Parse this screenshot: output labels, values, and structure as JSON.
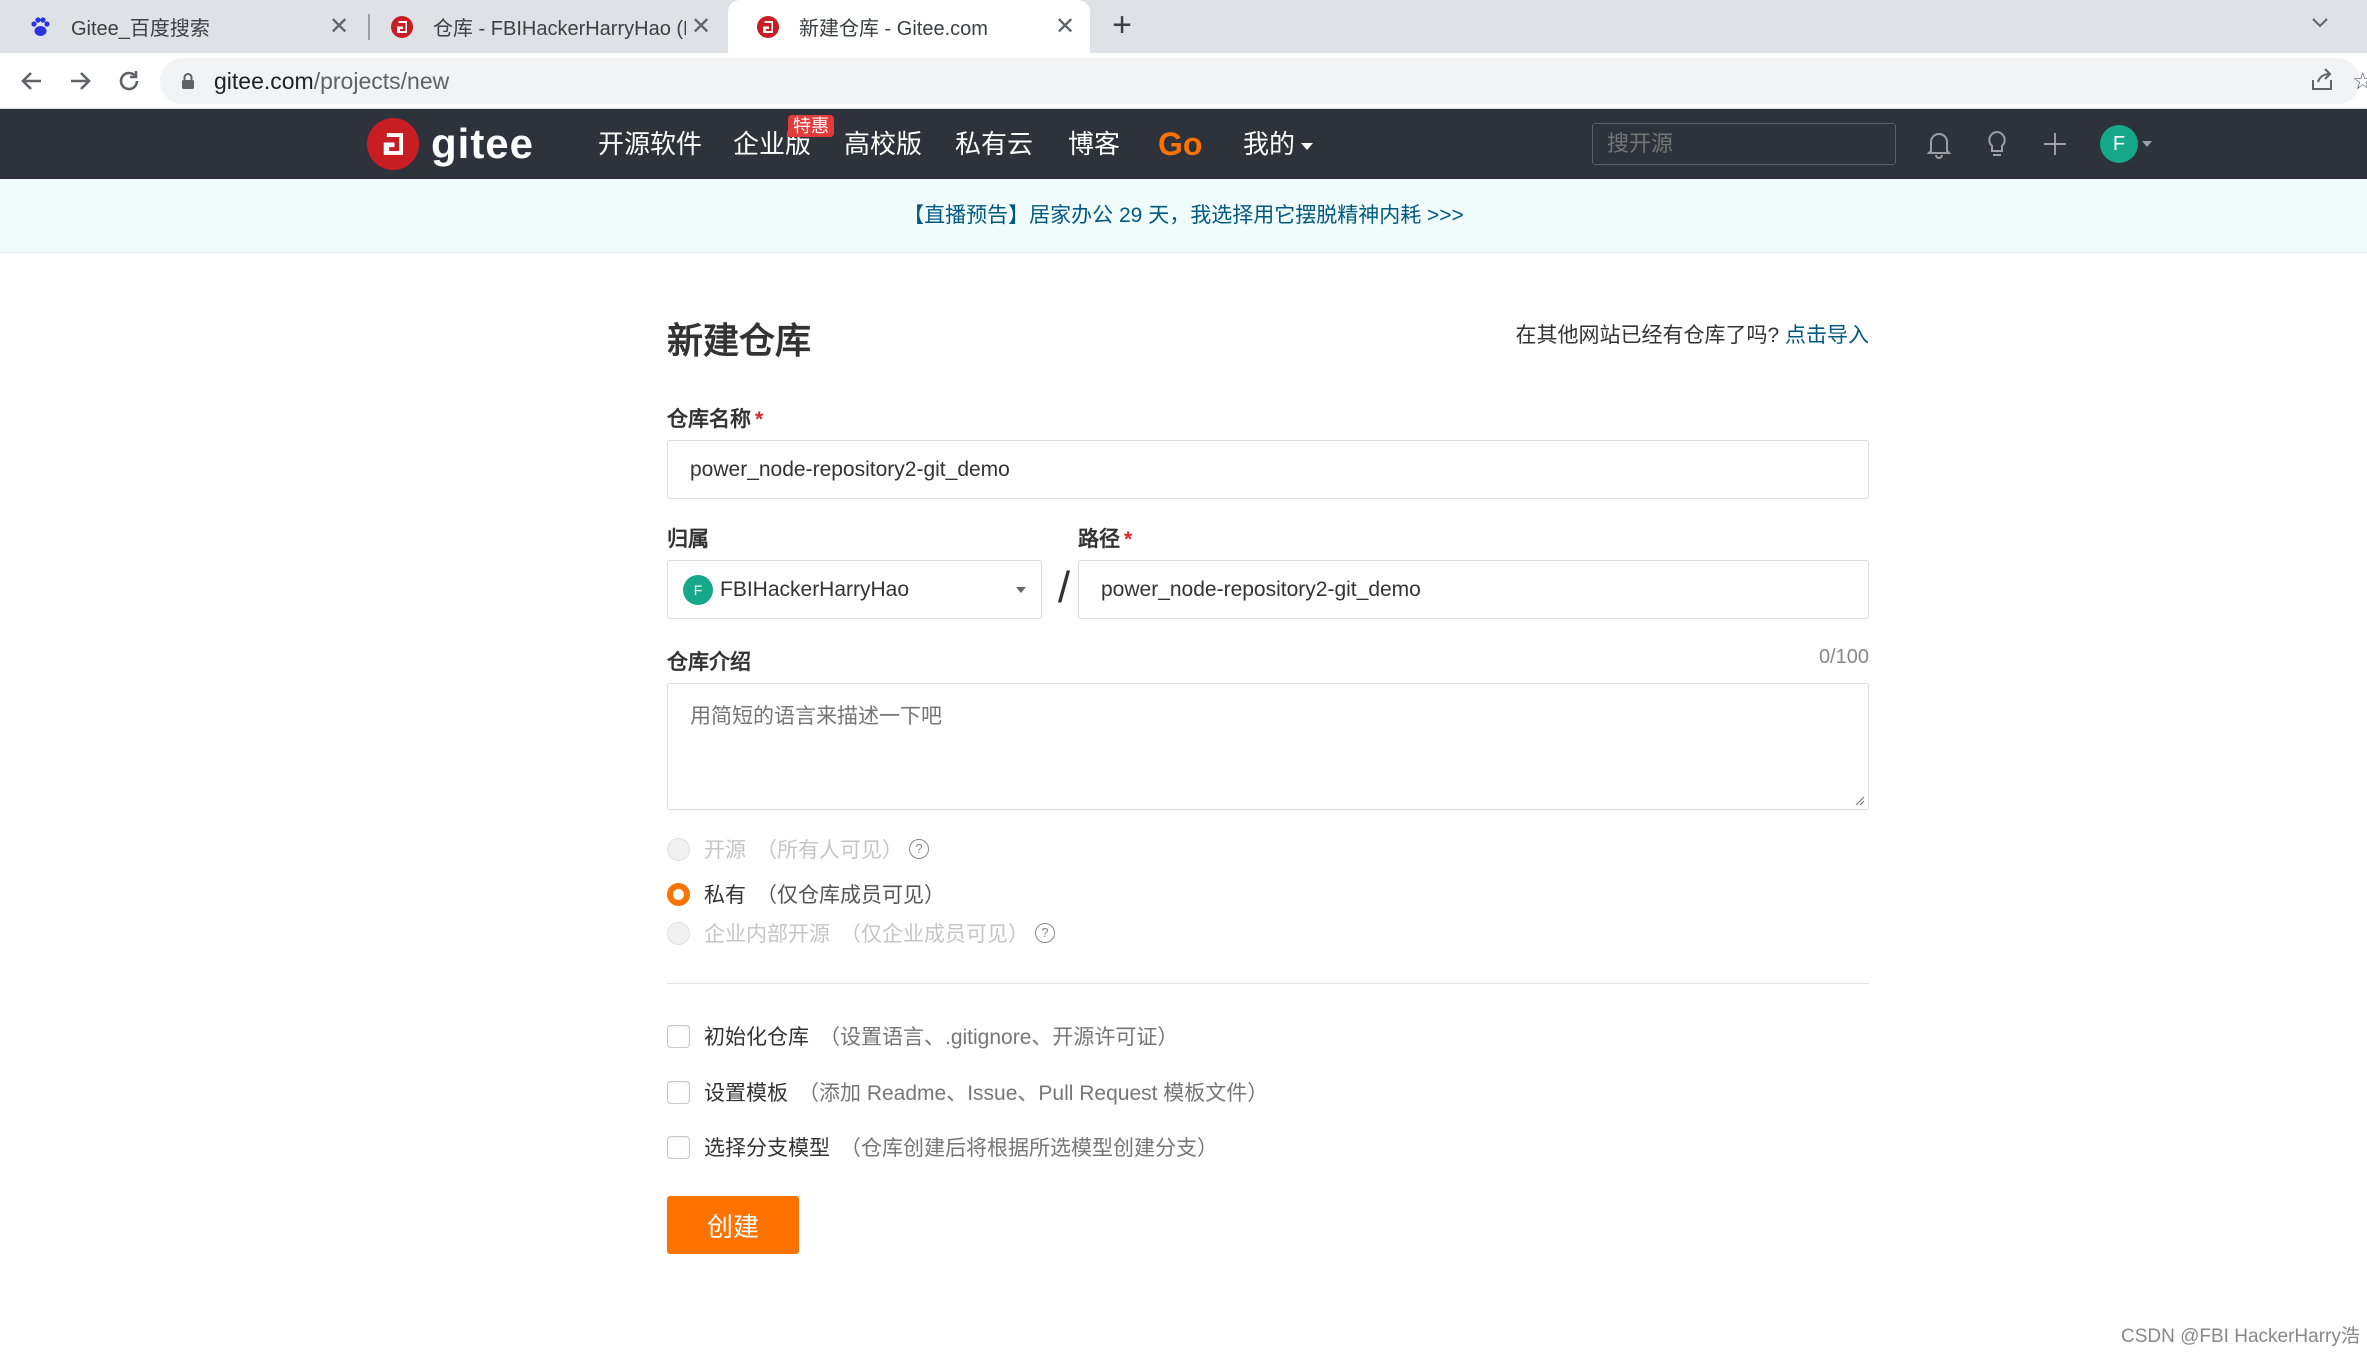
{
  "browser": {
    "tabs": [
      {
        "title": "Gitee_百度搜索",
        "icon": "baidu-paw-icon",
        "active": false
      },
      {
        "title": "仓库 - FBIHackerHarryHao (FB",
        "icon": "gitee-g-icon",
        "active": false
      },
      {
        "title": "新建仓库 - Gitee.com",
        "icon": "gitee-g-icon",
        "active": true
      }
    ],
    "new_tab": "+",
    "close_glyph": "✕",
    "url_host": "gitee.com",
    "url_path": "/projects/new"
  },
  "header": {
    "logo_text": "gitee",
    "nav": [
      "开源软件",
      "企业版",
      "高校版",
      "私有云",
      "博客",
      "Go",
      "我的"
    ],
    "badge": "特惠",
    "search_placeholder": "搜开源",
    "avatar_letter": "F",
    "accent_color": "#fe7300",
    "brand_color": "#c71d23"
  },
  "notice": {
    "text": "【直播预告】居家办公 29 天，我选择用它摆脱精神内耗 >>>"
  },
  "form": {
    "title": "新建仓库",
    "import_hint": "在其他网站已经有仓库了吗?",
    "import_link": "点击导入",
    "name_label": "仓库名称",
    "required_mark": "*",
    "name_value": "power_node-repository2-git_demo",
    "owner_label": "归属",
    "owner_avatar": "F",
    "owner_value": "FBIHackerHarryHao",
    "separator": "/",
    "path_label": "路径",
    "path_value": "power_node-repository2-git_demo",
    "desc_label": "仓库介绍",
    "desc_counter": "0/100",
    "desc_placeholder": "用简短的语言来描述一下吧",
    "visibility": [
      {
        "label": "开源",
        "sub": "（所有人可见）",
        "checked": false,
        "disabled": true,
        "help": true
      },
      {
        "label": "私有",
        "sub": "（仅仓库成员可见）",
        "checked": true,
        "disabled": false,
        "help": false
      },
      {
        "label": "企业内部开源",
        "sub": "（仅企业成员可见）",
        "checked": false,
        "disabled": true,
        "help": true
      }
    ],
    "options": [
      {
        "label": "初始化仓库",
        "sub": "（设置语言、.gitignore、开源许可证）",
        "checked": false
      },
      {
        "label": "设置模板",
        "sub": "（添加 Readme、Issue、Pull Request 模板文件）",
        "checked": false
      },
      {
        "label": "选择分支模型",
        "sub": "（仓库创建后将根据所选模型创建分支）",
        "checked": false
      }
    ],
    "help_glyph": "?",
    "submit_label": "创建"
  },
  "watermark": "CSDN @FBI HackerHarry浩"
}
